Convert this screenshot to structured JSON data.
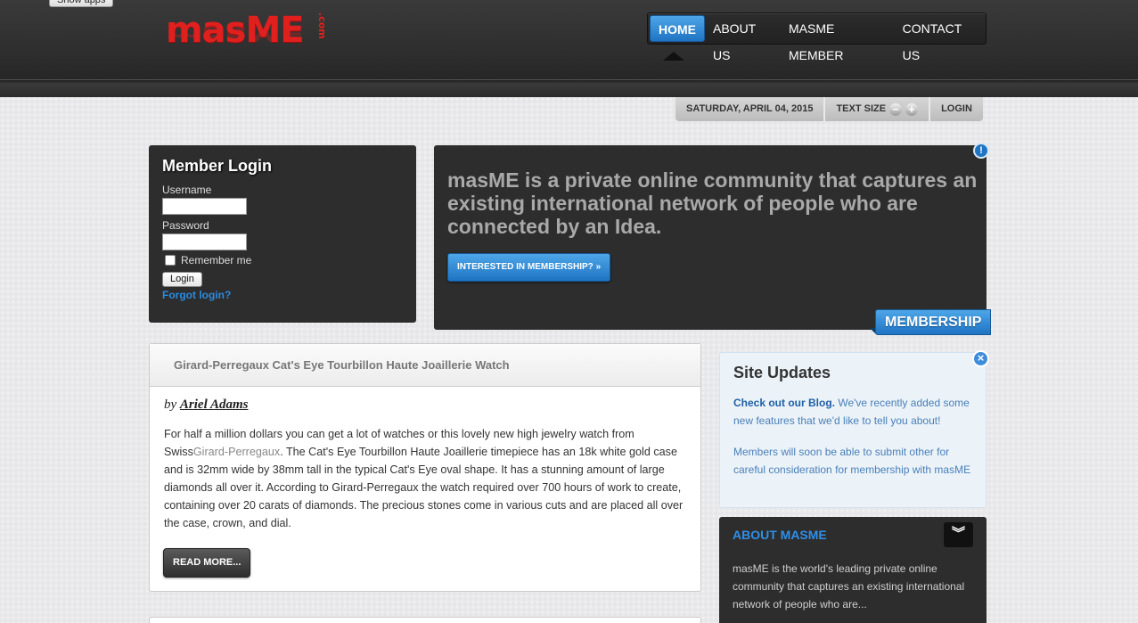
{
  "browser": {
    "show_apps_label": "Show apps"
  },
  "header": {
    "logo_main": "masME",
    "logo_suffix": ".com",
    "nav": [
      {
        "label": "HOME",
        "active": true
      },
      {
        "label": "ABOUT US",
        "active": false
      },
      {
        "label": "MASME MEMBER",
        "active": false
      },
      {
        "label": "CONTACT US",
        "active": false
      }
    ]
  },
  "toolbar": {
    "date": "SATURDAY, APRIL 04, 2015",
    "text_size_label": "TEXT SIZE",
    "decrease_symbol": "−",
    "increase_symbol": "+",
    "login_label": "LOGIN"
  },
  "login": {
    "title": "Member Login",
    "username_label": "Username",
    "username_value": "",
    "password_label": "Password",
    "password_value": "",
    "remember_label": "Remember me",
    "remember_checked": false,
    "submit_label": "Login",
    "forgot_label": "Forgot login?"
  },
  "hero": {
    "text": "masME is a private online community that captures an existing international network of people who are connected by an Idea.",
    "button_label": "INTERESTED IN MEMBERSHIP? »",
    "ribbon_label": "MEMBERSHIP",
    "info_symbol": "!"
  },
  "article": {
    "title": "Girard-Perregaux Cat's Eye Tourbillon Haute Joaillerie Watch",
    "by_prefix": "by",
    "author": "Ariel Adams",
    "body_before": "For half a million dollars you can get a lot of watches or this lovely new high jewelry watch from Swiss",
    "brand_link": "Girard-Perregaux",
    "body_after": ". The Cat's Eye Tourbillon Haute Joaillerie timepiece has an 18k white gold case and is 32mm wide by 38mm tall in the typical Cat's Eye oval shape. It has a stunning amount of large diamonds all over it. According to Girard-Perregaux the watch required over 700 hours of work to create, containing over 20 carats of diamonds. The precious stones come in various cuts and are placed all over the case, crown, and dial.",
    "read_more_label": "READ MORE..."
  },
  "site_updates": {
    "title": "Site Updates",
    "p1_strong": "Check out our Blog.",
    "p1_rest": " We've recently added some new features that we'd like to tell you about!",
    "p2": "Members will soon be able to submit other for careful consideration for membership with masME",
    "close_symbol": "×"
  },
  "about": {
    "title": "ABOUT MASME",
    "text": "masME is the world's leading private online community that captures an existing international network of people who are...",
    "toggle_symbol": "︾"
  },
  "colors": {
    "accent_blue": "#1f74c3",
    "logo_red": "#e0201f",
    "panel_dark": "#2d2d2d"
  }
}
